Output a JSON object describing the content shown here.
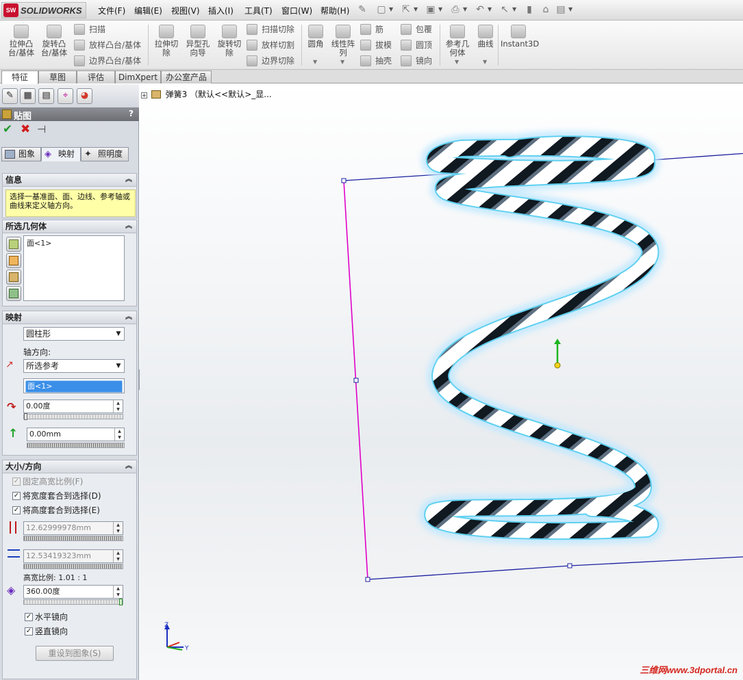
{
  "app": {
    "logo_text": "SOLIDWORKS",
    "logo_badge": "SW",
    "menus": [
      "文件(F)",
      "编辑(E)",
      "视图(V)",
      "插入(I)",
      "工具(T)",
      "窗口(W)",
      "帮助(H)"
    ]
  },
  "commands": {
    "extrude_boss": "拉伸凸\n台/基体",
    "revolve_boss": "旋转凸\n台/基体",
    "sweep": "扫描",
    "loft": "放样凸台/基体",
    "boundary_boss": "边界凸台/基体",
    "extrude_cut": "拉伸切\n除",
    "hole_wizard": "异型孔\n向导",
    "revolve_cut": "旋转切\n除",
    "swept_cut": "扫描切除",
    "lofted_cut": "放样切割",
    "boundary_cut": "边界切除",
    "fillet": "圆角",
    "linear_pattern": "线性阵\n列",
    "rib": "筋",
    "draft": "拔模",
    "shell": "抽壳",
    "wrap": "包覆",
    "dome": "圆顶",
    "mirror": "镜向",
    "ref_geometry": "参考几\n何体",
    "curves": "曲线",
    "instant3d": "Instant3D"
  },
  "tabs": [
    "特征",
    "草图",
    "评估",
    "DimXpert",
    "办公室产品"
  ],
  "property_manager": {
    "title": "贴图",
    "help": "?",
    "subtabs": [
      "图象",
      "映射",
      "照明度"
    ],
    "info": {
      "header": "信息",
      "text": "选择一基准面、面、边线、参考轴或曲线来定义轴方向。"
    },
    "selected_geometry": {
      "header": "所选几何体",
      "items": [
        "面<1>"
      ]
    },
    "mapping": {
      "header": "映射",
      "type": "圆柱形",
      "axis_label": "轴方向:",
      "axis_value": "所选参考",
      "axis_selection": "面<1>",
      "rotation": "0.00度",
      "offset": "0.00mm",
      "rotation_level": 0.0
    },
    "size_orientation": {
      "header": "大小/方向",
      "fixed_aspect_label": "固定高宽比例(F)",
      "fixed_aspect_checked": true,
      "fit_width_label": "将宽度套合到选择(D)",
      "fit_width_checked": true,
      "fit_height_label": "将高度套合到选择(E)",
      "fit_height_checked": true,
      "height": "12.62999978mm",
      "width": "12.53419323mm",
      "aspect_ratio": "高宽比例: 1.01 : 1",
      "rotation_angle": "360.00度",
      "rotation_level": 1.0,
      "mirror_h_label": "水平镜向",
      "mirror_h_checked": true,
      "mirror_v_label": "竖直镜向",
      "mirror_v_checked": true,
      "reset_label": "重设到图象(S)"
    }
  },
  "viewport": {
    "tree_text": "弹簧3 （默认<<默认>_显...",
    "triad_z": "Z",
    "triad_y": "Y",
    "watermark": "三维网www.3dportal.cn"
  },
  "colors": {
    "spring_outline": "#5fd0f0",
    "plane_edge": "#1b1f9e",
    "selected_edge": "#e000c8"
  }
}
